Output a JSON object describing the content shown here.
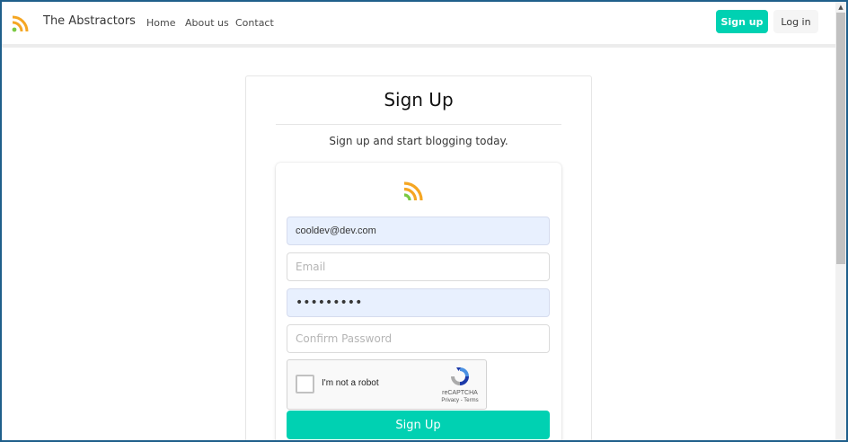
{
  "navbar": {
    "brand_name": "The Abstractors",
    "links": [
      "Home",
      "About us",
      "Contact"
    ],
    "signup_label": "Sign up",
    "login_label": "Log in"
  },
  "main": {
    "title": "Sign Up",
    "subtitle": "Sign up and start blogging today."
  },
  "form": {
    "username_value": "cooldev@dev.com",
    "email_placeholder": "Email",
    "password_value": "•••••••••",
    "confirm_placeholder": "Confirm Password",
    "captcha_label": "I'm not a robot",
    "captcha_brand": "reCAPTCHA",
    "captcha_links": "Privacy - Terms",
    "submit_label": "Sign Up"
  },
  "colors": {
    "primary": "#00d1b2",
    "logo_orange": "#f5a623",
    "logo_green": "#7ac943",
    "autofill_bg": "#e8f0fe"
  },
  "icons": {
    "brand": "rss-feed-icon",
    "form": "rss-feed-icon",
    "captcha": "recaptcha-icon"
  }
}
